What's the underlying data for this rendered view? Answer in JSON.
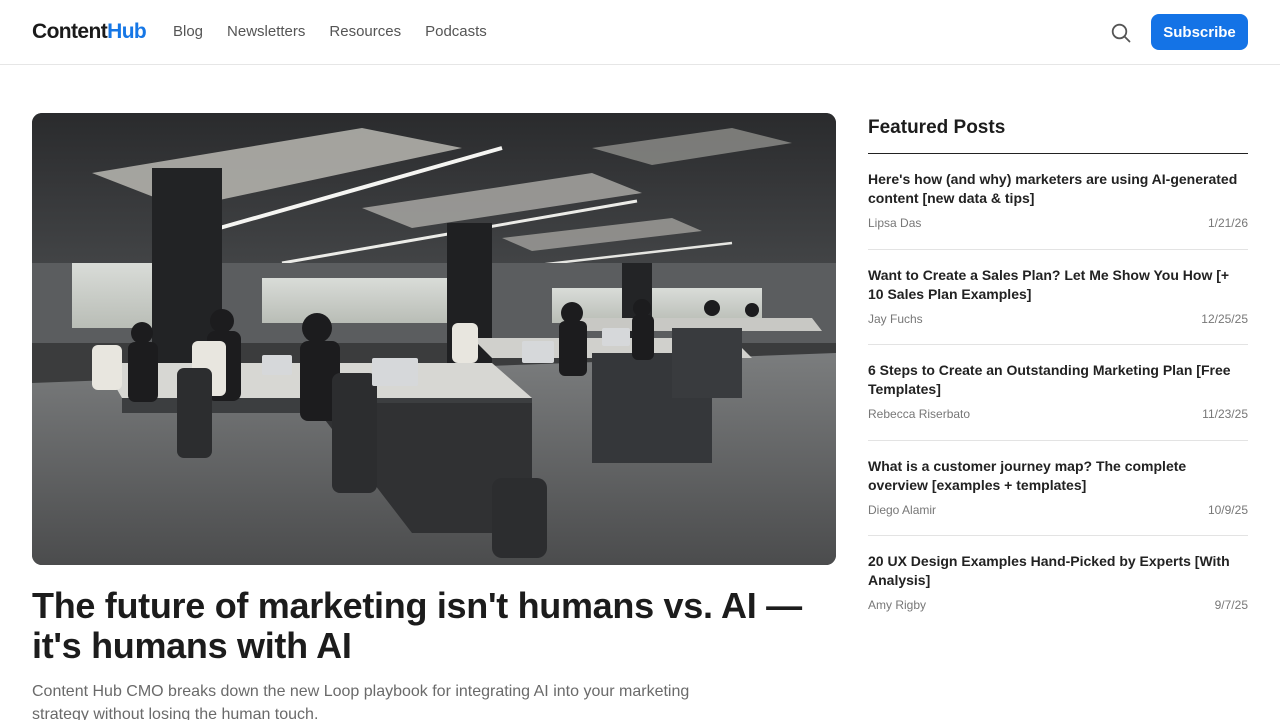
{
  "header": {
    "logo_main": "Content",
    "logo_accent": "Hub",
    "nav": [
      {
        "label": "Blog"
      },
      {
        "label": "Newsletters"
      },
      {
        "label": "Resources"
      },
      {
        "label": "Podcasts"
      }
    ],
    "search_icon": "search-icon",
    "subscribe_label": "Subscribe",
    "accent_color": "#1473e6"
  },
  "hero": {
    "image_alt": "People working on laptops in a large open-plan office",
    "title": "The future of marketing isn't humans vs. AI — it's humans with AI",
    "subtitle": "Content Hub CMO breaks down the new Loop playbook for integrating AI into your marketing strategy without losing the human touch."
  },
  "featured": {
    "heading": "Featured Posts",
    "posts": [
      {
        "title": "Here's how (and why) marketers are using AI-generated content [new data & tips]",
        "author": "Lipsa Das",
        "date": "1/21/26"
      },
      {
        "title": "Want to Create a Sales Plan? Let Me Show You How [+ 10 Sales Plan Examples]",
        "author": "Jay Fuchs",
        "date": "12/25/25"
      },
      {
        "title": "6 Steps to Create an Outstanding Marketing Plan [Free Templates]",
        "author": "Rebecca Riserbato",
        "date": "11/23/25"
      },
      {
        "title": "What is a customer journey map? The complete overview [examples + templates]",
        "author": "Diego Alamir",
        "date": "10/9/25"
      },
      {
        "title": "20 UX Design Examples Hand-Picked by Experts [With Analysis]",
        "author": "Amy Rigby",
        "date": "9/7/25"
      }
    ]
  }
}
